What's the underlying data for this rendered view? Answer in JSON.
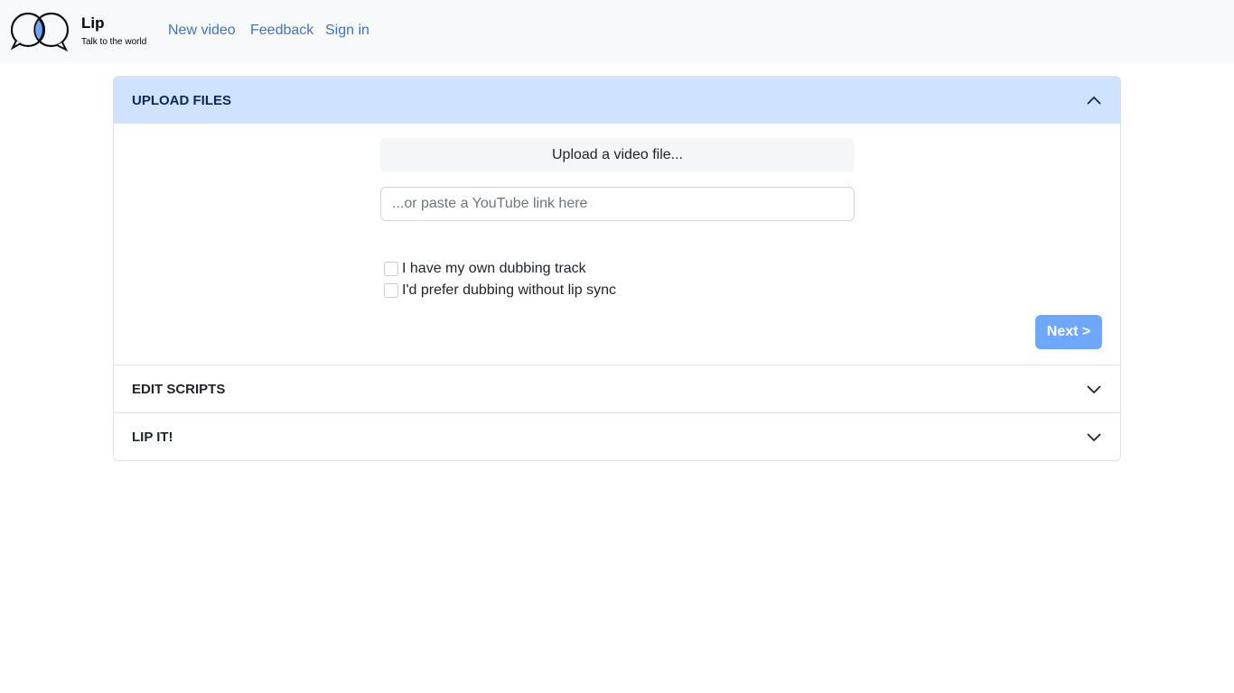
{
  "brand": {
    "name": "Lip",
    "tagline": "Talk to the world"
  },
  "nav": {
    "links": [
      {
        "label": "New video"
      },
      {
        "label": "Feedback"
      },
      {
        "label": "Sign in"
      }
    ]
  },
  "accordion": {
    "upload": {
      "title": "UPLOAD FILES",
      "upload_button": "Upload a video file...",
      "youtube_placeholder": "...or paste a YouTube link here",
      "youtube_value": "",
      "checkbox_own_track": "I have my own dubbing track",
      "checkbox_no_lipsync": "I'd prefer dubbing without lip sync",
      "next_button": "Next >"
    },
    "edit": {
      "title": "EDIT SCRIPTS"
    },
    "lipit": {
      "title": "LIP IT!"
    }
  },
  "colors": {
    "accent": "#6ea8fe",
    "link": "#3b73d6",
    "active_header": "#cfe2ff"
  }
}
